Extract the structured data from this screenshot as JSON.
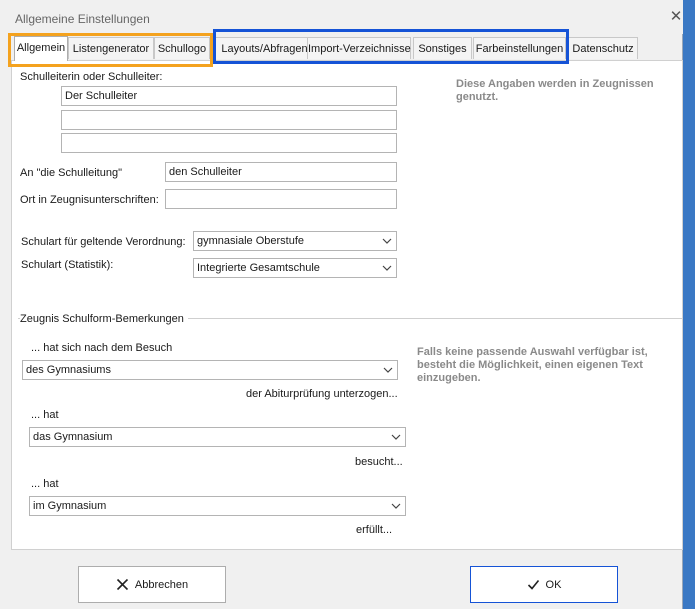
{
  "window": {
    "title": "Allgemeine Einstellungen"
  },
  "tabs": [
    "Allgemein",
    "Listengenerator",
    "Schullogo",
    "Layouts/Abfragen",
    "Import-Verzeichnisse",
    "Sonstiges",
    "Farbeinstellungen",
    "Datenschutz"
  ],
  "active_tab": "Allgemein",
  "form": {
    "schulleiter_label": "Schulleiterin oder Schulleiter:",
    "schulleiter_line1": "Der Schulleiter",
    "schulleiter_line2": "",
    "schulleiter_line3": "",
    "hint_top": "Diese Angaben werden in Zeugnissen genutzt.",
    "an_label": "An \"die Schulleitung\"",
    "an_value": "den Schulleiter",
    "ort_label": "Ort in Zeugnisunterschriften:",
    "ort_value": "",
    "schulart_vo_label": "Schulart für geltende Verordnung:",
    "schulart_vo_value": "gymnasiale Oberstufe",
    "schulart_stat_label": "Schulart (Statistik):",
    "schulart_stat_value": "Integrierte Gesamtschule"
  },
  "bemerkungen": {
    "group_label": "Zeugnis Schulform-Bemerkungen",
    "label1": "... hat sich nach dem Besuch",
    "select1": "des Gymnasiums",
    "suffix1": "der Abiturprüfung  unterzogen...",
    "label2": "... hat",
    "select2": "das Gymnasium",
    "suffix2": "besucht...",
    "label3": "... hat",
    "select3": "im Gymnasium",
    "suffix3": "erfüllt...",
    "hint": "Falls keine passende Auswahl verfügbar ist, besteht die Möglichkeit, einen eigenen Text einzugeben."
  },
  "buttons": {
    "cancel": "Abbrechen",
    "ok": "OK"
  },
  "colors": {
    "highlight_orange": "#f4a21e",
    "highlight_blue": "#1553d6"
  },
  "icons": {
    "close": "close-icon",
    "cancel": "x-icon",
    "ok": "checkmark-icon",
    "dropdown": "chevron-down-icon"
  }
}
